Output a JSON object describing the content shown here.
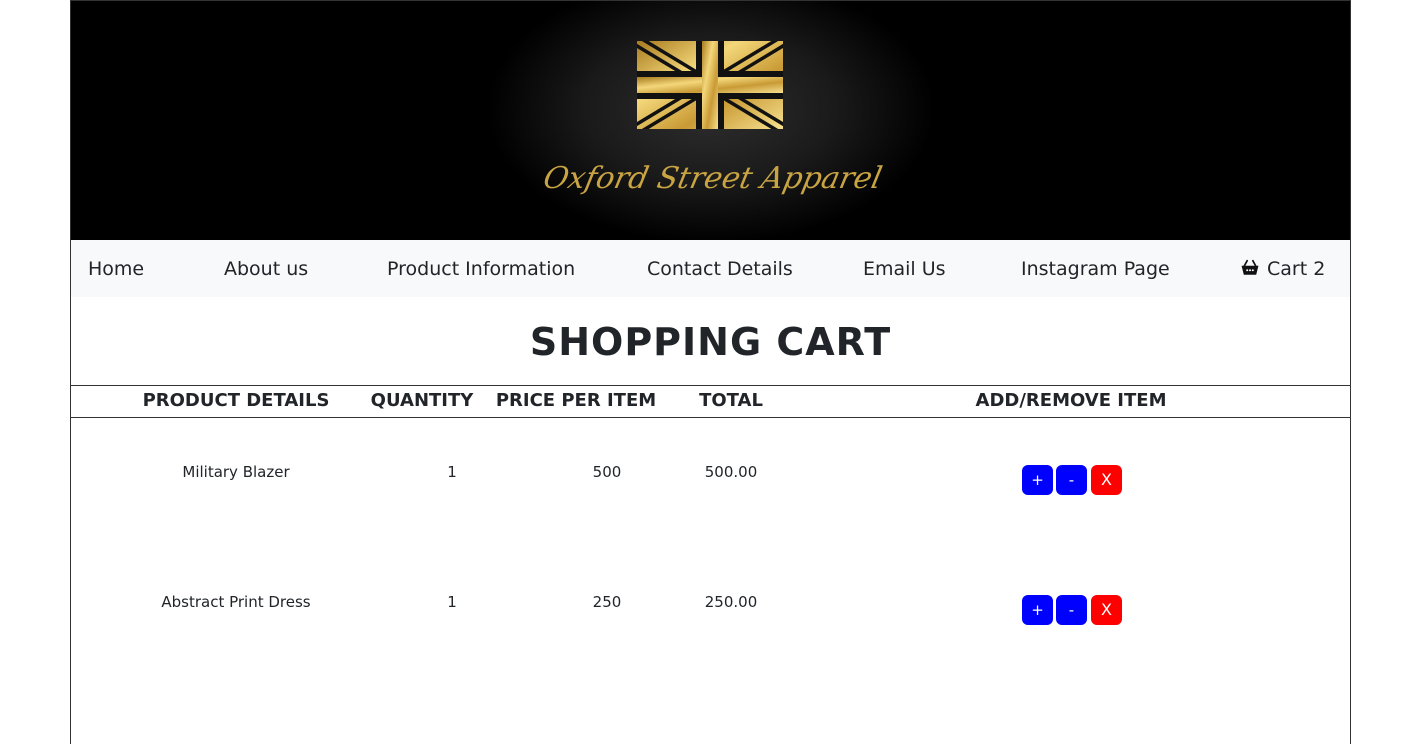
{
  "brand": {
    "logo_text": "Oxford Street Apparel"
  },
  "nav": {
    "items": [
      {
        "label": "Home"
      },
      {
        "label": "About us"
      },
      {
        "label": "Product Information"
      },
      {
        "label": "Contact Details"
      },
      {
        "label": "Email Us"
      },
      {
        "label": "Instagram Page"
      }
    ],
    "cart_label": "Cart 2"
  },
  "page_title": "SHOPPING CART",
  "table": {
    "headers": [
      "PRODUCT DETAILS",
      "QUANTITY",
      "PRICE PER ITEM",
      "TOTAL",
      "ADD/REMOVE ITEM"
    ],
    "rows": [
      {
        "product": "Military Blazer",
        "quantity": "1",
        "price": "500",
        "total": "500.00"
      },
      {
        "product": "Abstract Print Dress",
        "quantity": "1",
        "price": "250",
        "total": "250.00"
      }
    ]
  },
  "buttons": {
    "add": "+",
    "subtract": "-",
    "remove": "X"
  },
  "colors": {
    "banner": "#000000",
    "gold": "#c9a443",
    "add_button": "#0000ff",
    "remove_button": "#ff0000",
    "navbar": "#f8f9fa"
  },
  "icons": {
    "cart": "shopping-basket-icon",
    "logo": "union-jack-flag-icon"
  }
}
